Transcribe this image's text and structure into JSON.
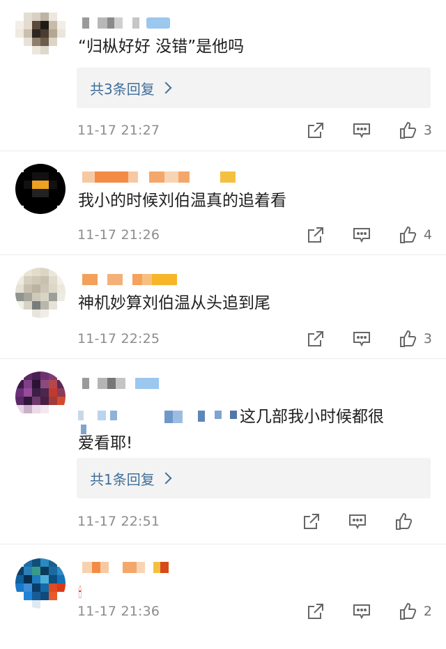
{
  "comments": [
    {
      "text": "“归枞好好 没错”是他吗",
      "reply_label": "共3条回复",
      "time": "11-17 21:27",
      "likes": "3",
      "avatar_colors": [
        "#e8e2d8",
        "#d9cbb8",
        "#3a3a3a",
        "#8c7a64",
        "#e6e0d6",
        "#f2efe9"
      ]
    },
    {
      "text": "我小的时候刘伯温真的追着看",
      "time": "11-17 21:26",
      "likes": "4",
      "avatar_colors": [
        "#000000",
        "#111111",
        "#f0a020",
        "#222222",
        "#000000",
        "#ffffff"
      ]
    },
    {
      "text": "神机妙算刘伯温从头追到尾",
      "time": "11-17 22:25",
      "likes": "3",
      "avatar_colors": [
        "#e9e4d6",
        "#cfc9bb",
        "#b3ad9f",
        "#8f8a7d",
        "#f1ede4",
        "#ffffff"
      ]
    },
    {
      "text_tail": "这几部我小时候都很",
      "text_line2": "爱看耶!",
      "reply_label": "共1条回复",
      "time": "11-17 22:51",
      "likes": "",
      "avatar_colors": [
        "#6a2f6e",
        "#3b1a4a",
        "#8a3d80",
        "#c02a2a",
        "#2c1c3c",
        "#ffffff"
      ]
    },
    {
      "emoji": "🕯",
      "time": "11-17 21:36",
      "likes": "2",
      "avatar_colors": [
        "#0f5c8a",
        "#1e88c8",
        "#0b3c66",
        "#e04020",
        "#1a6fa8",
        "#ffffff"
      ]
    }
  ],
  "icons": {
    "share": "share-icon",
    "comment": "comment-icon",
    "like": "thumbs-up-icon"
  }
}
